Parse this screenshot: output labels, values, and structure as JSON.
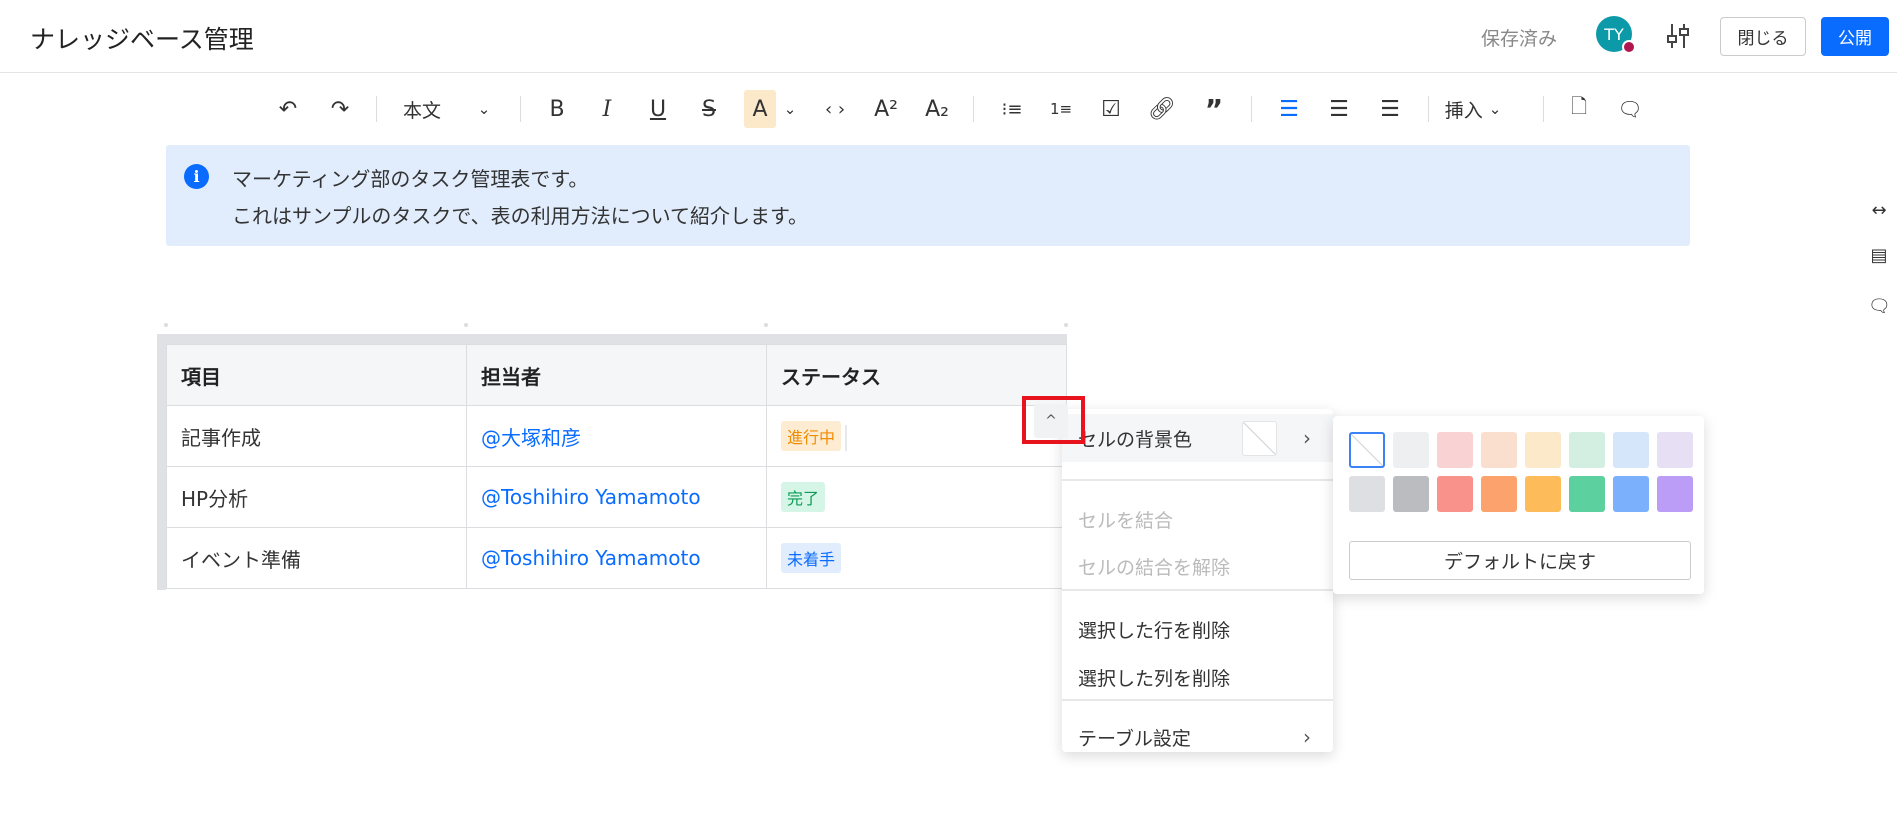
{
  "header": {
    "title": "ナレッジベース管理",
    "saved": "保存済み",
    "avatar": "TY",
    "close": "閉じる",
    "publish": "公開"
  },
  "toolbar": {
    "style": "本文",
    "insert": "挿入"
  },
  "info": {
    "line1": "マーケティング部のタスク管理表です。",
    "line2": "これはサンプルのタスクで、表の利用方法について紹介します。"
  },
  "table": {
    "headers": [
      "項目",
      "担当者",
      "ステータス"
    ],
    "rows": [
      [
        "記事作成",
        "@大塚和彦",
        "進行中"
      ],
      [
        "HP分析",
        "@Toshihiro Yamamoto",
        "完了"
      ],
      [
        "イベント準備",
        "@Toshihiro Yamamoto",
        "未着手"
      ]
    ]
  },
  "status_colors": {
    "進行中": [
      "#fdecd2",
      "#f08c00"
    ],
    "完了": [
      "#d5f5e6",
      "#0c9a56"
    ],
    "未着手": [
      "#e1edfd",
      "#0a6cff"
    ]
  },
  "menu": {
    "bg": "セルの背景色",
    "merge": "セルを結合",
    "unmerge": "セルの結合を解除",
    "del_row": "選択した行を削除",
    "del_col": "選択した列を削除",
    "table_settings": "テーブル設定"
  },
  "colors": {
    "row1": [
      "none",
      "#eeeff1",
      "#f9d3d3",
      "#fadfcf",
      "#fbe9c9",
      "#d3efe2",
      "#d6e6fa",
      "#e7e0f5"
    ],
    "row2": [
      "#dedfe2",
      "#bbbcbf",
      "#f8928a",
      "#fca36d",
      "#fdbb5a",
      "#5dd0a0",
      "#7bb0fd",
      "#bb9cf7"
    ],
    "reset": "デフォルトに戻す"
  }
}
